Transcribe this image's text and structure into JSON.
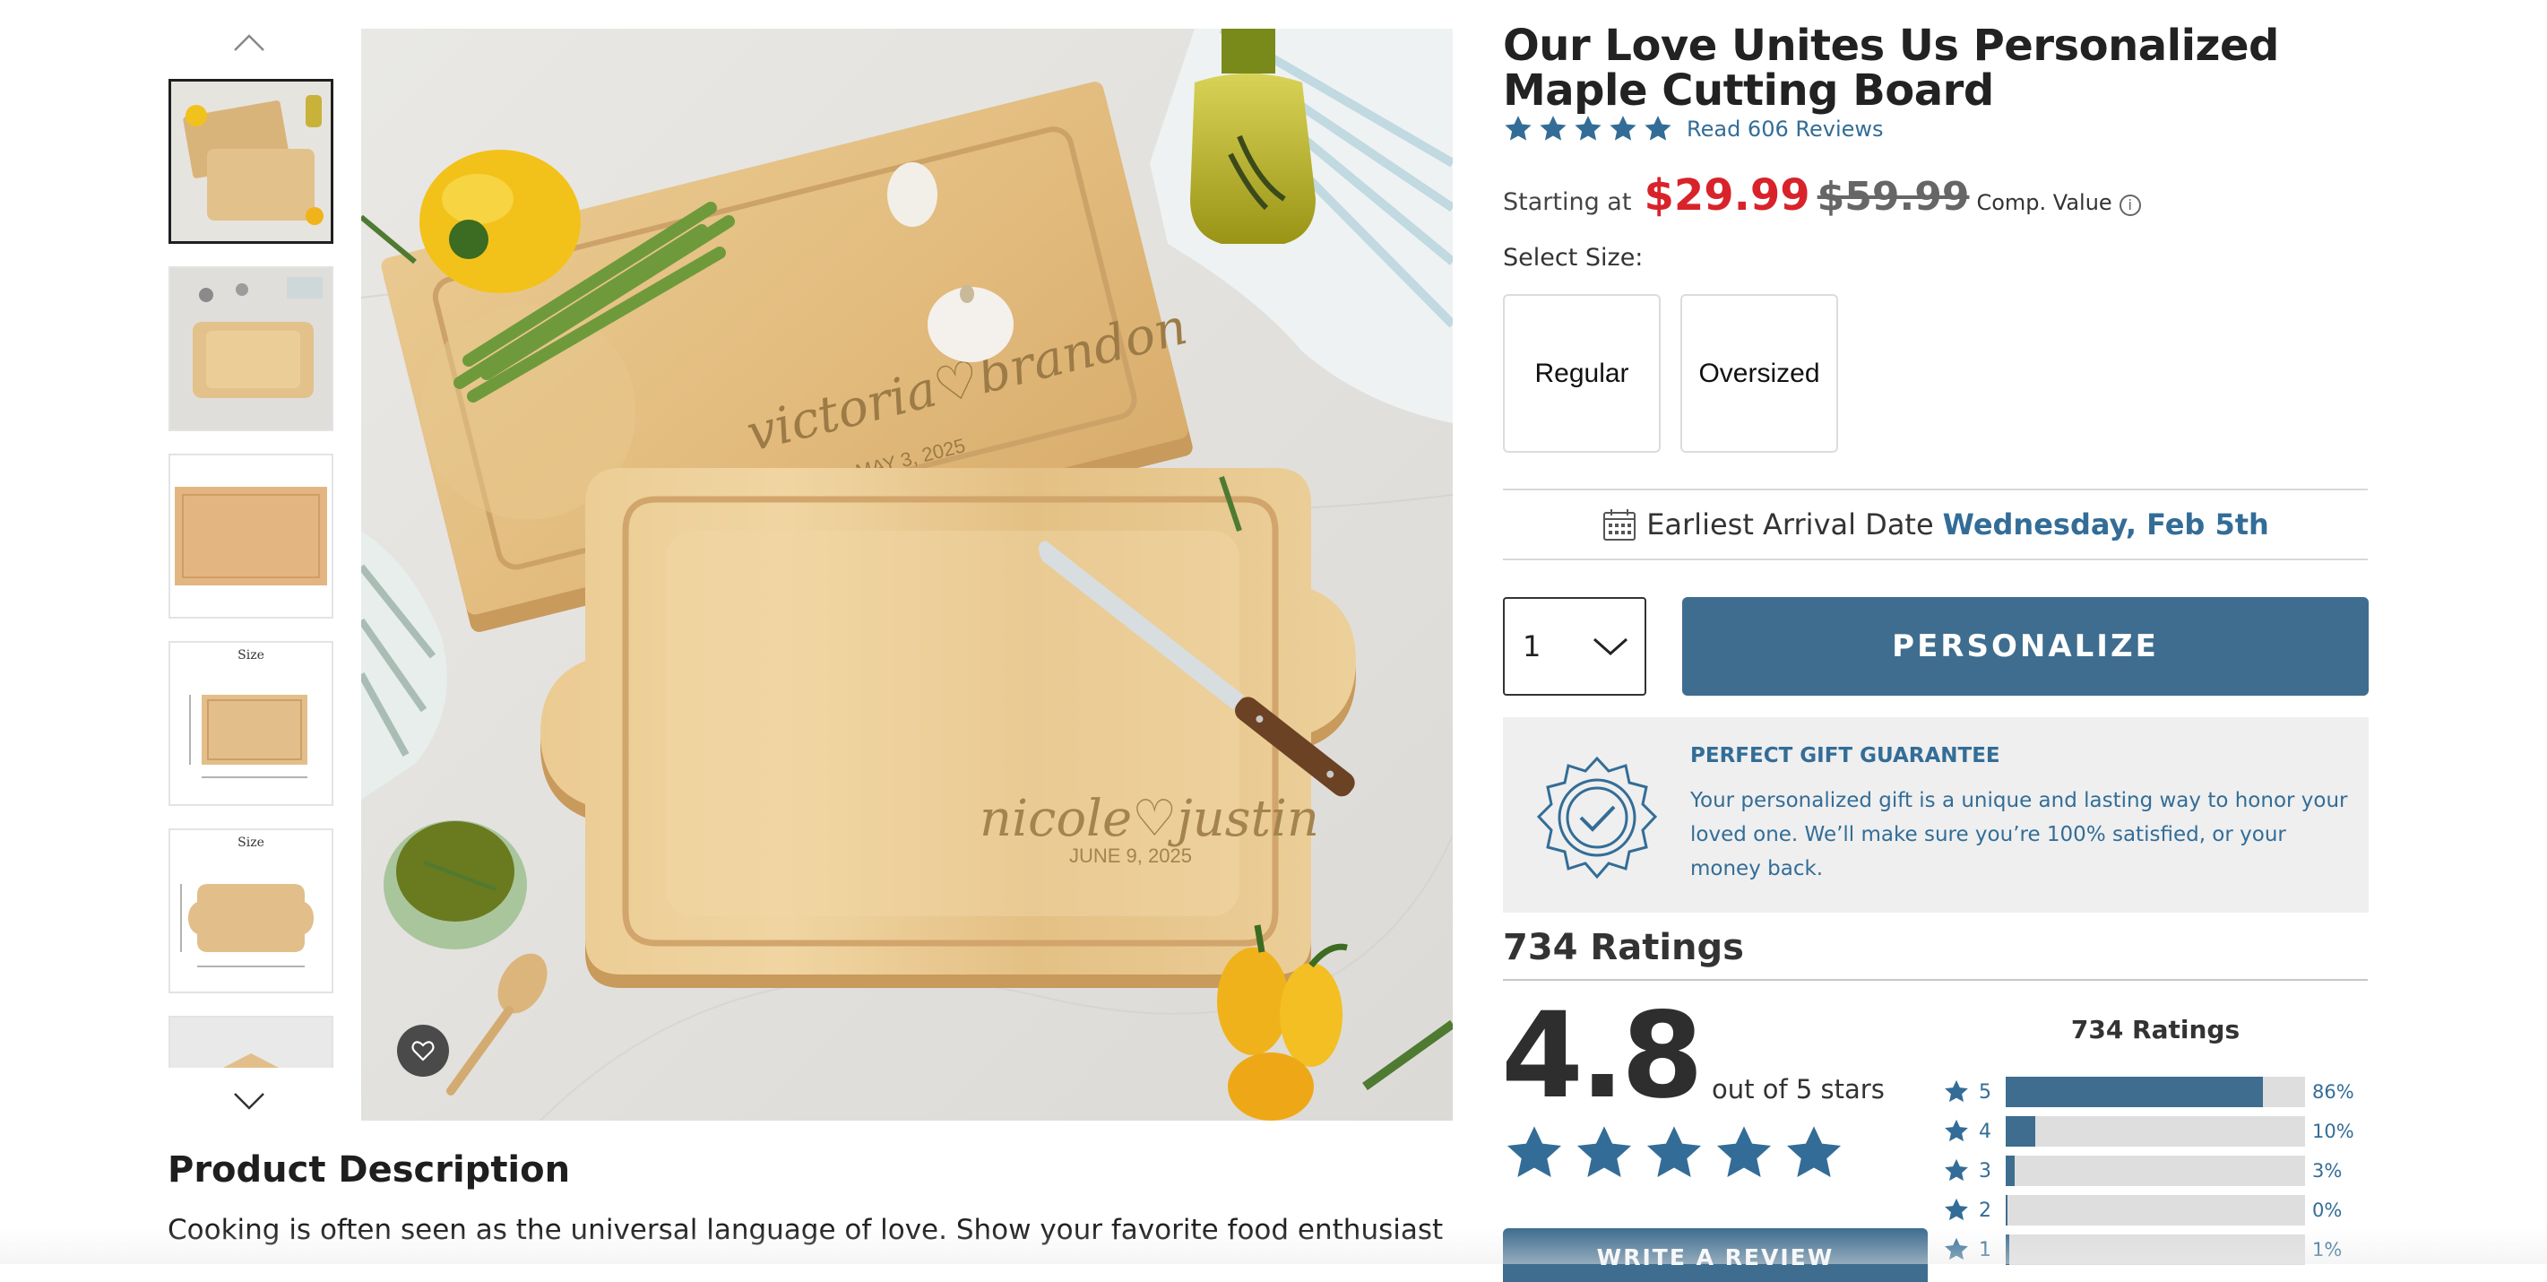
{
  "product": {
    "title": "Our Love Unites Us Personalized Maple Cutting Board",
    "reviews_link": "Read 606 Reviews",
    "price_label": "Starting at",
    "price_now": "$29.99",
    "price_was": "$59.99",
    "comp_value": "Comp. Value",
    "info_glyph": "i",
    "accent_color": "#3e6d8f",
    "sale_color": "#d8232a"
  },
  "gallery": {
    "thumb_size_label": "Size",
    "main_image": {
      "engraving_top_names": "victoria♡brandon",
      "engraving_top_date": "MAY 3, 2025",
      "engraving_bottom_names": "nicole♡justin",
      "engraving_bottom_date": "JUNE 9, 2025"
    }
  },
  "size": {
    "label": "Select Size:",
    "options": [
      "Regular",
      "Oversized"
    ]
  },
  "arrival": {
    "label": "Earliest Arrival Date",
    "date": "Wednesday, Feb 5th"
  },
  "purchase": {
    "quantity": "1",
    "personalize_label": "PERSONALIZE"
  },
  "guarantee": {
    "title": "PERFECT GIFT GUARANTEE",
    "text": "Your personalized gift is a unique and lasting way to honor your loved one. We’ll make sure you’re 100% satisfied, or your money back."
  },
  "ratings": {
    "heading": "734 Ratings",
    "average": "4.8",
    "out_of": "out of 5 stars",
    "write_review": "WRITE A REVIEW",
    "histogram_title": "734 Ratings",
    "histogram": [
      {
        "stars": "5",
        "pct_label": "86%",
        "fraction": 0.86
      },
      {
        "stars": "4",
        "pct_label": "10%",
        "fraction": 0.1
      },
      {
        "stars": "3",
        "pct_label": "3%",
        "fraction": 0.03
      },
      {
        "stars": "2",
        "pct_label": "0%",
        "fraction": 0.0
      },
      {
        "stars": "1",
        "pct_label": "1%",
        "fraction": 0.01
      }
    ]
  },
  "description": {
    "heading": "Product Description",
    "text": "Cooking is often seen as the universal language of love. Show your favorite food enthusiast"
  }
}
